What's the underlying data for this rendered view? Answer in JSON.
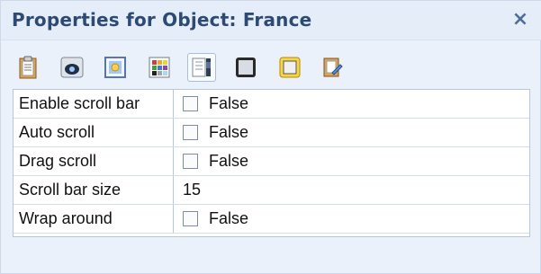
{
  "window": {
    "title": "Properties for Object: France",
    "close_label": "×"
  },
  "toolbar": {
    "icons": [
      {
        "name": "clipboard-icon"
      },
      {
        "name": "eye-icon"
      },
      {
        "name": "image-icon"
      },
      {
        "name": "color-palette-icon"
      },
      {
        "name": "scroll-properties-icon",
        "active": true
      },
      {
        "name": "frame-icon"
      },
      {
        "name": "border-icon"
      },
      {
        "name": "edit-document-icon"
      }
    ]
  },
  "properties": [
    {
      "label": "Enable scroll bar",
      "type": "checkbox",
      "value": "False",
      "checked": false
    },
    {
      "label": "Auto scroll",
      "type": "checkbox",
      "value": "False",
      "checked": false
    },
    {
      "label": "Drag scroll",
      "type": "checkbox",
      "value": "False",
      "checked": false
    },
    {
      "label": "Scroll bar size",
      "type": "text",
      "value": "15"
    },
    {
      "label": "Wrap around",
      "type": "checkbox",
      "value": "False",
      "checked": false
    }
  ],
  "colors": {
    "title": "#2d4a74",
    "panel_bg": "#eaf1fb",
    "grid_border": "#b9c7db"
  }
}
